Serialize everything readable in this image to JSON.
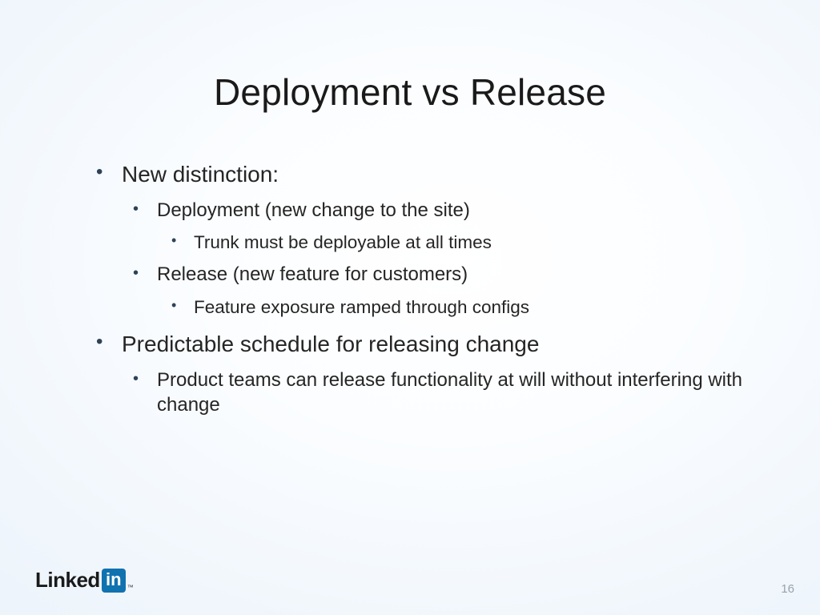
{
  "slide": {
    "title": "Deployment vs Release",
    "pageNumber": "16",
    "logo": {
      "text1": "Linked",
      "text2": "in",
      "tm": "™"
    },
    "bullets": [
      {
        "text": "New distinction:",
        "children": [
          {
            "text": "Deployment (new change to the site)",
            "children": [
              {
                "text": "Trunk must be deployable at all times"
              }
            ]
          },
          {
            "text": "Release (new feature for customers)",
            "children": [
              {
                "text": "Feature exposure ramped through configs"
              }
            ]
          }
        ]
      },
      {
        "text": "Predictable schedule for releasing change",
        "children": [
          {
            "text": "Product teams can release functionality at will without interfering with change"
          }
        ]
      }
    ]
  }
}
